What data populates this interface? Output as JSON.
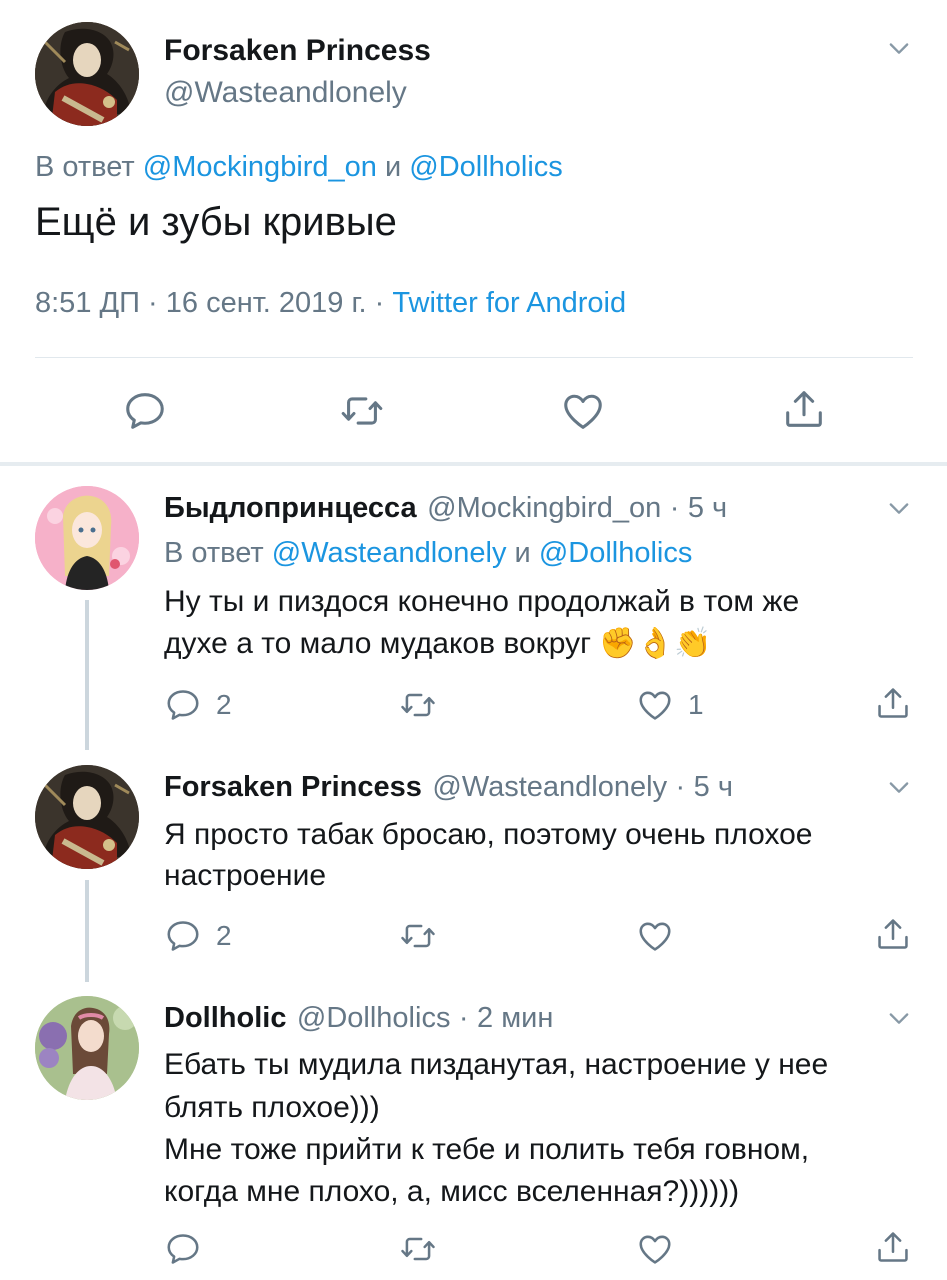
{
  "colors": {
    "link": "#1b95e0",
    "muted": "#657786",
    "text": "#14171a",
    "divider": "#e1e8ed",
    "thread_line": "#ccd6dd"
  },
  "main_tweet": {
    "author_name": "Forsaken Princess",
    "author_handle": "@Wasteandlonely",
    "reply_prefix": "В ответ",
    "reply_to_1": "@Mockingbird_on",
    "reply_and": "и",
    "reply_to_2": "@Dollholics",
    "text": "Ещё и зубы кривые",
    "time": "8:51 ДП",
    "date": "16 сент. 2019 г.",
    "separator": "·",
    "source": "Twitter for Android",
    "icons": [
      "reply-icon",
      "retweet-icon",
      "like-icon",
      "share-icon"
    ]
  },
  "replies": [
    {
      "author_name": "Быдлопринцесса",
      "author_handle": "@Mockingbird_on",
      "time": "5 ч",
      "reply_prefix": "В ответ",
      "reply_to_1": "@Wasteandlonely",
      "reply_and": "и",
      "reply_to_2": "@Dollholics",
      "lines": [
        "Ну ты и пиздося конечно продолжай в том же",
        "духе а то мало мудаков вокруг"
      ],
      "emoji": "✊👌👏",
      "reply_count": "2",
      "retweet_count": "",
      "like_count": "1"
    },
    {
      "author_name": "Forsaken Princess",
      "author_handle": "@Wasteandlonely",
      "time": "5 ч",
      "lines": [
        "Я просто табак бросаю, поэтому очень плохое",
        "настроение"
      ],
      "reply_count": "2",
      "retweet_count": "",
      "like_count": ""
    },
    {
      "author_name": "Dollholic",
      "author_handle": "@Dollholics",
      "time": "2 мин",
      "lines": [
        "Ебать ты мудила пизданутая, настроение у нее",
        "блять плохое)))",
        "Мне тоже прийти к тебе и полить тебя говном,",
        "когда мне плохо, а, мисс вселенная?))))))"
      ],
      "reply_count": "",
      "retweet_count": "",
      "like_count": ""
    }
  ]
}
